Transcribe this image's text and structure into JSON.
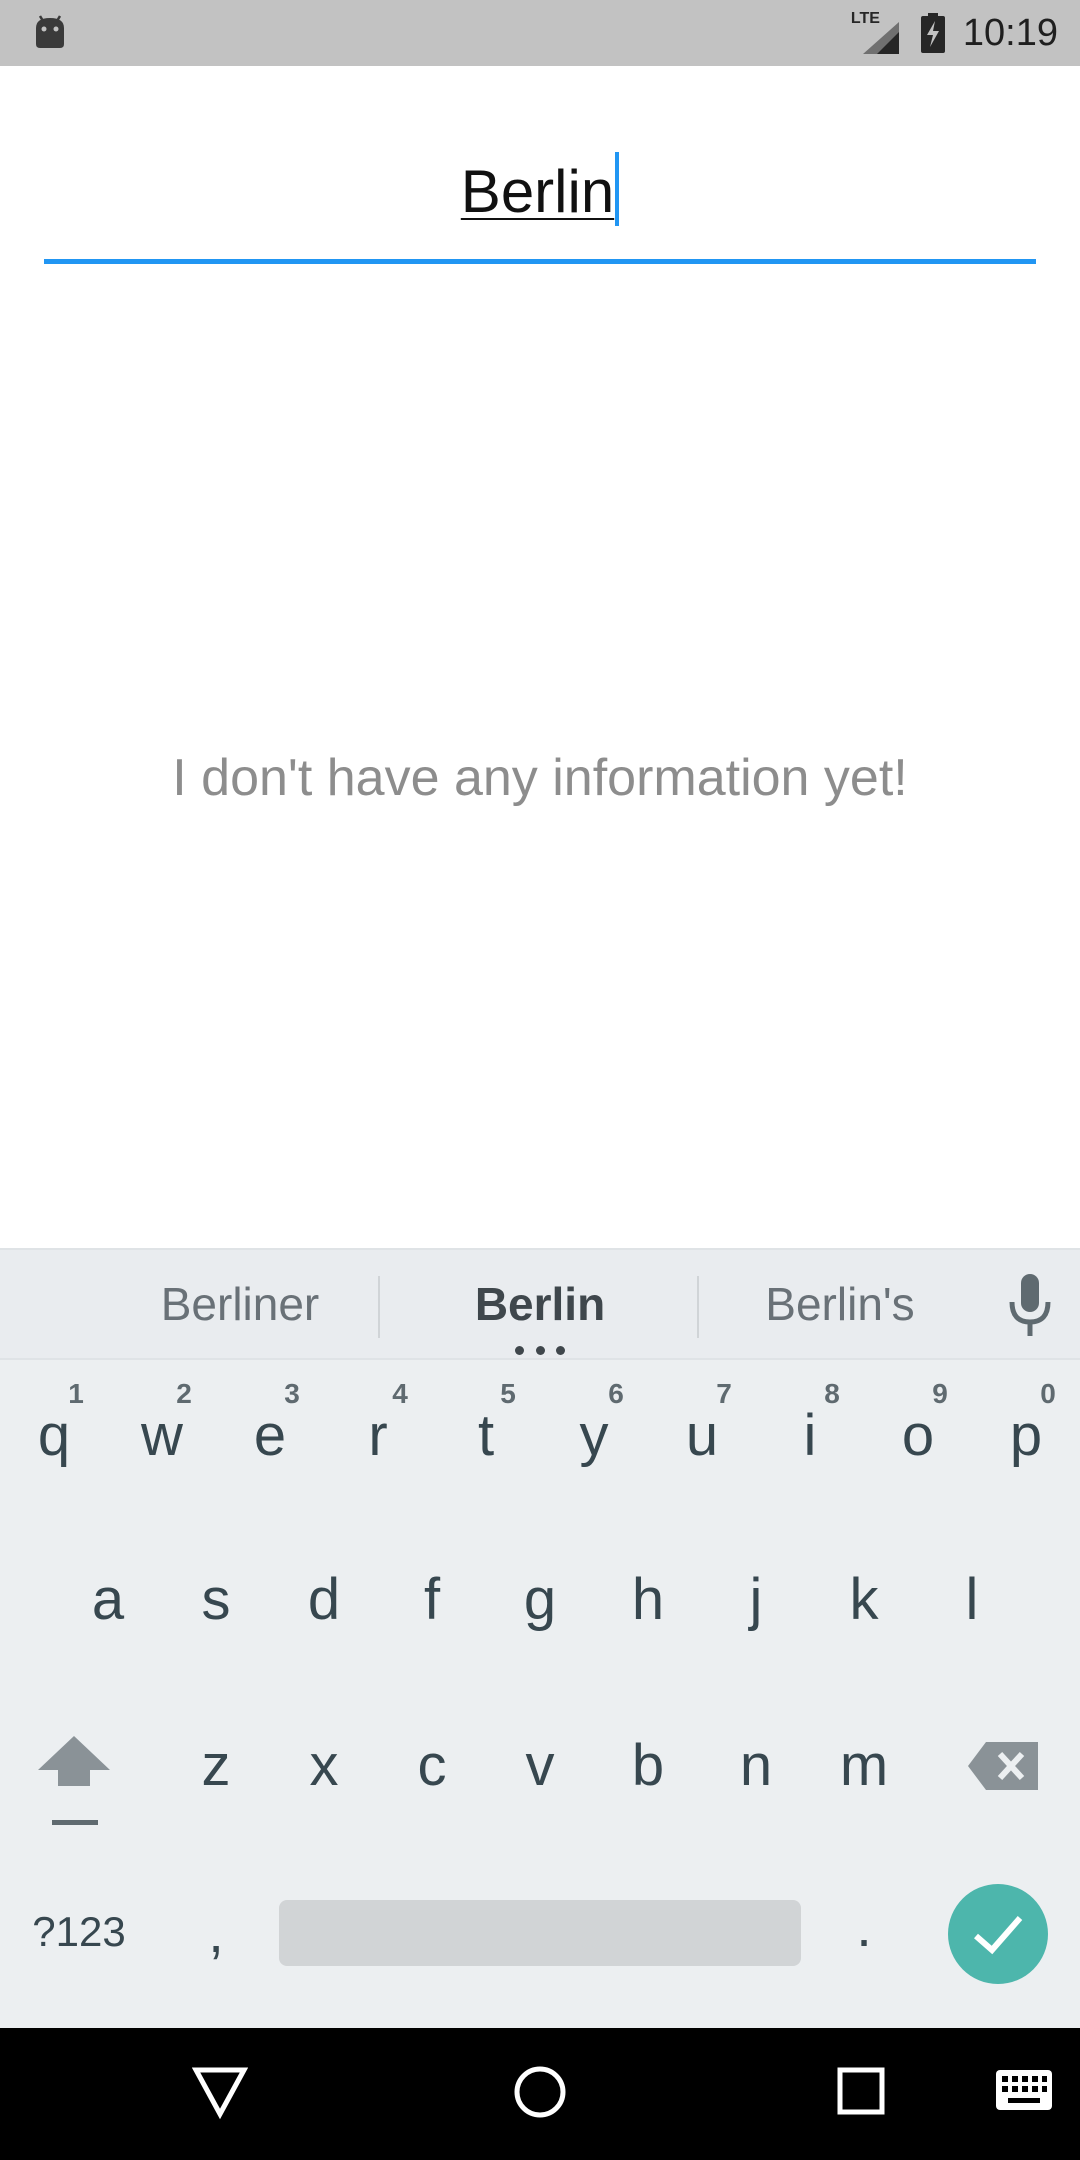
{
  "status_bar": {
    "network_label": "LTE",
    "time": "10:19"
  },
  "search": {
    "value": "Berlin"
  },
  "main": {
    "empty_message": "I don't have any information yet!"
  },
  "keyboard": {
    "suggestions": [
      "Berliner",
      "Berlin",
      "Berlin's"
    ],
    "row1": [
      {
        "key": "q",
        "hint": "1"
      },
      {
        "key": "w",
        "hint": "2"
      },
      {
        "key": "e",
        "hint": "3"
      },
      {
        "key": "r",
        "hint": "4"
      },
      {
        "key": "t",
        "hint": "5"
      },
      {
        "key": "y",
        "hint": "6"
      },
      {
        "key": "u",
        "hint": "7"
      },
      {
        "key": "i",
        "hint": "8"
      },
      {
        "key": "o",
        "hint": "9"
      },
      {
        "key": "p",
        "hint": "0"
      }
    ],
    "row2": [
      "a",
      "s",
      "d",
      "f",
      "g",
      "h",
      "j",
      "k",
      "l"
    ],
    "row3": [
      "z",
      "x",
      "c",
      "v",
      "b",
      "n",
      "m"
    ],
    "symbols_label": "?123",
    "comma_label": ",",
    "period_label": "."
  },
  "icons": {
    "android": "android-icon",
    "signal": "signal-icon",
    "battery": "battery-charging-icon",
    "mic": "mic-icon",
    "shift": "shift-icon",
    "backspace": "backspace-icon",
    "enter": "checkmark-icon",
    "back": "back-triangle-icon",
    "home": "home-circle-icon",
    "recents": "recents-square-icon",
    "keyboard_switch": "keyboard-icon"
  },
  "colors": {
    "accent": "#2196f3",
    "enter_button": "#4db6ac",
    "status_bar": "#c2c2c2",
    "keyboard_bg": "#eceff1"
  }
}
